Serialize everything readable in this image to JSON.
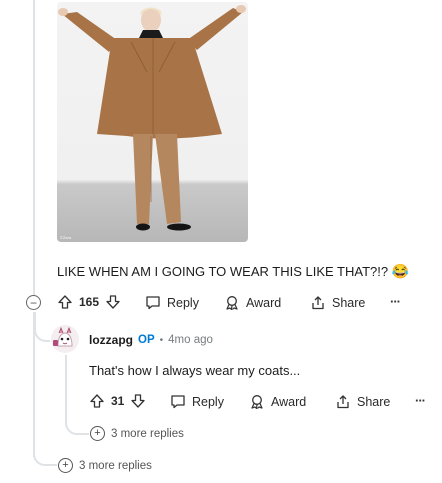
{
  "post_image": {
    "credit": "©Zara"
  },
  "comment1": {
    "text": "LIKE WHEN AM I GOING TO WEAR THIS LIKE THAT?!?",
    "emoji": "😂",
    "score": "165",
    "reply_label": "Reply",
    "award_label": "Award",
    "share_label": "Share",
    "more_label": "···",
    "collapse_symbol": "−"
  },
  "comment2": {
    "username": "lozzapg",
    "op_badge": "OP",
    "separator": "•",
    "time": "4mo ago",
    "text": "That's how I always wear my coats...",
    "score": "31",
    "reply_label": "Reply",
    "award_label": "Award",
    "share_label": "Share",
    "more_label": "···",
    "more_replies": "3 more replies"
  },
  "thread": {
    "more_replies": "3 more replies",
    "plus_symbol": "+"
  },
  "colors": {
    "op_badge": "#0079d3",
    "thread_line": "#dfe3e6",
    "coat": "#a87447"
  }
}
